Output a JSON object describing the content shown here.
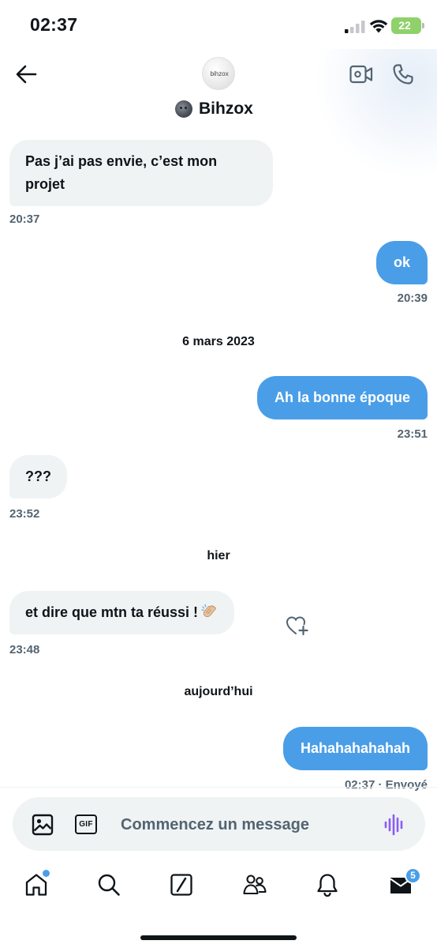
{
  "status_bar": {
    "time": "02:37",
    "battery": "22"
  },
  "header": {
    "avatar_text": "bihzox",
    "contact_name": "Bihzox"
  },
  "conversation": {
    "messages": [
      {
        "direction": "incoming",
        "text": "Pas j’ai pas envie, c’est mon projet",
        "time": "20:37"
      },
      {
        "direction": "outgoing",
        "text": "ok",
        "time": "20:39"
      },
      {
        "direction": "outgoing",
        "text": "Ah la bonne époque",
        "time": "23:51"
      },
      {
        "direction": "incoming",
        "text": "???",
        "time": "23:52"
      },
      {
        "direction": "incoming",
        "text": "et dire que mtn ta réussi !",
        "emoji": "clapping-hands",
        "time": "23:48"
      },
      {
        "direction": "outgoing",
        "text": "Hahahahahahah",
        "time": "02:37 · Envoyé"
      }
    ],
    "date_separators": [
      "6 mars 2023",
      "hier",
      "aujourd’hui"
    ]
  },
  "composer": {
    "placeholder": "Commencez un message",
    "gif_label": "GIF"
  },
  "tab_bar": {
    "tabs": [
      "home-icon",
      "search-icon",
      "grok-icon",
      "communities-icon",
      "notifications-icon",
      "messages-icon"
    ],
    "messages_badge": "5"
  },
  "colors": {
    "accent": "#4a9ee8",
    "incoming_bubble": "#eff3f4",
    "secondary_text": "#536471",
    "voice_icon": "#8b5cf6"
  }
}
